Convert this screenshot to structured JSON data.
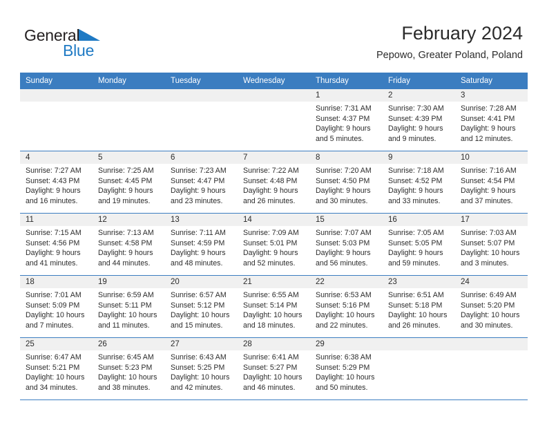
{
  "brand": {
    "word_top": "General",
    "word_bottom": "Blue",
    "triangle_icon": "brand-triangle-icon",
    "color_blue": "#1f7ac4",
    "color_black": "#231f20"
  },
  "header": {
    "title": "February 2024",
    "subtitle": "Pepowo, Greater Poland, Poland"
  },
  "theme": {
    "header_row_bg": "#3b7dc0",
    "daynum_band_bg": "#f0f0f0",
    "cell_bg": "#ffffff",
    "text": "#2b2b2b"
  },
  "weekday_headers": [
    "Sunday",
    "Monday",
    "Tuesday",
    "Wednesday",
    "Thursday",
    "Friday",
    "Saturday"
  ],
  "weeks": [
    [
      {
        "day": "",
        "empty": true
      },
      {
        "day": "",
        "empty": true
      },
      {
        "day": "",
        "empty": true
      },
      {
        "day": "",
        "empty": true
      },
      {
        "day": "1",
        "sunrise": "Sunrise: 7:31 AM",
        "sunset": "Sunset: 4:37 PM",
        "daylight_1": "Daylight: 9 hours",
        "daylight_2": "and 5 minutes."
      },
      {
        "day": "2",
        "sunrise": "Sunrise: 7:30 AM",
        "sunset": "Sunset: 4:39 PM",
        "daylight_1": "Daylight: 9 hours",
        "daylight_2": "and 9 minutes."
      },
      {
        "day": "3",
        "sunrise": "Sunrise: 7:28 AM",
        "sunset": "Sunset: 4:41 PM",
        "daylight_1": "Daylight: 9 hours",
        "daylight_2": "and 12 minutes."
      }
    ],
    [
      {
        "day": "4",
        "sunrise": "Sunrise: 7:27 AM",
        "sunset": "Sunset: 4:43 PM",
        "daylight_1": "Daylight: 9 hours",
        "daylight_2": "and 16 minutes."
      },
      {
        "day": "5",
        "sunrise": "Sunrise: 7:25 AM",
        "sunset": "Sunset: 4:45 PM",
        "daylight_1": "Daylight: 9 hours",
        "daylight_2": "and 19 minutes."
      },
      {
        "day": "6",
        "sunrise": "Sunrise: 7:23 AM",
        "sunset": "Sunset: 4:47 PM",
        "daylight_1": "Daylight: 9 hours",
        "daylight_2": "and 23 minutes."
      },
      {
        "day": "7",
        "sunrise": "Sunrise: 7:22 AM",
        "sunset": "Sunset: 4:48 PM",
        "daylight_1": "Daylight: 9 hours",
        "daylight_2": "and 26 minutes."
      },
      {
        "day": "8",
        "sunrise": "Sunrise: 7:20 AM",
        "sunset": "Sunset: 4:50 PM",
        "daylight_1": "Daylight: 9 hours",
        "daylight_2": "and 30 minutes."
      },
      {
        "day": "9",
        "sunrise": "Sunrise: 7:18 AM",
        "sunset": "Sunset: 4:52 PM",
        "daylight_1": "Daylight: 9 hours",
        "daylight_2": "and 33 minutes."
      },
      {
        "day": "10",
        "sunrise": "Sunrise: 7:16 AM",
        "sunset": "Sunset: 4:54 PM",
        "daylight_1": "Daylight: 9 hours",
        "daylight_2": "and 37 minutes."
      }
    ],
    [
      {
        "day": "11",
        "sunrise": "Sunrise: 7:15 AM",
        "sunset": "Sunset: 4:56 PM",
        "daylight_1": "Daylight: 9 hours",
        "daylight_2": "and 41 minutes."
      },
      {
        "day": "12",
        "sunrise": "Sunrise: 7:13 AM",
        "sunset": "Sunset: 4:58 PM",
        "daylight_1": "Daylight: 9 hours",
        "daylight_2": "and 44 minutes."
      },
      {
        "day": "13",
        "sunrise": "Sunrise: 7:11 AM",
        "sunset": "Sunset: 4:59 PM",
        "daylight_1": "Daylight: 9 hours",
        "daylight_2": "and 48 minutes."
      },
      {
        "day": "14",
        "sunrise": "Sunrise: 7:09 AM",
        "sunset": "Sunset: 5:01 PM",
        "daylight_1": "Daylight: 9 hours",
        "daylight_2": "and 52 minutes."
      },
      {
        "day": "15",
        "sunrise": "Sunrise: 7:07 AM",
        "sunset": "Sunset: 5:03 PM",
        "daylight_1": "Daylight: 9 hours",
        "daylight_2": "and 56 minutes."
      },
      {
        "day": "16",
        "sunrise": "Sunrise: 7:05 AM",
        "sunset": "Sunset: 5:05 PM",
        "daylight_1": "Daylight: 9 hours",
        "daylight_2": "and 59 minutes."
      },
      {
        "day": "17",
        "sunrise": "Sunrise: 7:03 AM",
        "sunset": "Sunset: 5:07 PM",
        "daylight_1": "Daylight: 10 hours",
        "daylight_2": "and 3 minutes."
      }
    ],
    [
      {
        "day": "18",
        "sunrise": "Sunrise: 7:01 AM",
        "sunset": "Sunset: 5:09 PM",
        "daylight_1": "Daylight: 10 hours",
        "daylight_2": "and 7 minutes."
      },
      {
        "day": "19",
        "sunrise": "Sunrise: 6:59 AM",
        "sunset": "Sunset: 5:11 PM",
        "daylight_1": "Daylight: 10 hours",
        "daylight_2": "and 11 minutes."
      },
      {
        "day": "20",
        "sunrise": "Sunrise: 6:57 AM",
        "sunset": "Sunset: 5:12 PM",
        "daylight_1": "Daylight: 10 hours",
        "daylight_2": "and 15 minutes."
      },
      {
        "day": "21",
        "sunrise": "Sunrise: 6:55 AM",
        "sunset": "Sunset: 5:14 PM",
        "daylight_1": "Daylight: 10 hours",
        "daylight_2": "and 18 minutes."
      },
      {
        "day": "22",
        "sunrise": "Sunrise: 6:53 AM",
        "sunset": "Sunset: 5:16 PM",
        "daylight_1": "Daylight: 10 hours",
        "daylight_2": "and 22 minutes."
      },
      {
        "day": "23",
        "sunrise": "Sunrise: 6:51 AM",
        "sunset": "Sunset: 5:18 PM",
        "daylight_1": "Daylight: 10 hours",
        "daylight_2": "and 26 minutes."
      },
      {
        "day": "24",
        "sunrise": "Sunrise: 6:49 AM",
        "sunset": "Sunset: 5:20 PM",
        "daylight_1": "Daylight: 10 hours",
        "daylight_2": "and 30 minutes."
      }
    ],
    [
      {
        "day": "25",
        "sunrise": "Sunrise: 6:47 AM",
        "sunset": "Sunset: 5:21 PM",
        "daylight_1": "Daylight: 10 hours",
        "daylight_2": "and 34 minutes."
      },
      {
        "day": "26",
        "sunrise": "Sunrise: 6:45 AM",
        "sunset": "Sunset: 5:23 PM",
        "daylight_1": "Daylight: 10 hours",
        "daylight_2": "and 38 minutes."
      },
      {
        "day": "27",
        "sunrise": "Sunrise: 6:43 AM",
        "sunset": "Sunset: 5:25 PM",
        "daylight_1": "Daylight: 10 hours",
        "daylight_2": "and 42 minutes."
      },
      {
        "day": "28",
        "sunrise": "Sunrise: 6:41 AM",
        "sunset": "Sunset: 5:27 PM",
        "daylight_1": "Daylight: 10 hours",
        "daylight_2": "and 46 minutes."
      },
      {
        "day": "29",
        "sunrise": "Sunrise: 6:38 AM",
        "sunset": "Sunset: 5:29 PM",
        "daylight_1": "Daylight: 10 hours",
        "daylight_2": "and 50 minutes."
      },
      {
        "day": "",
        "empty": true
      },
      {
        "day": "",
        "empty": true
      }
    ]
  ]
}
